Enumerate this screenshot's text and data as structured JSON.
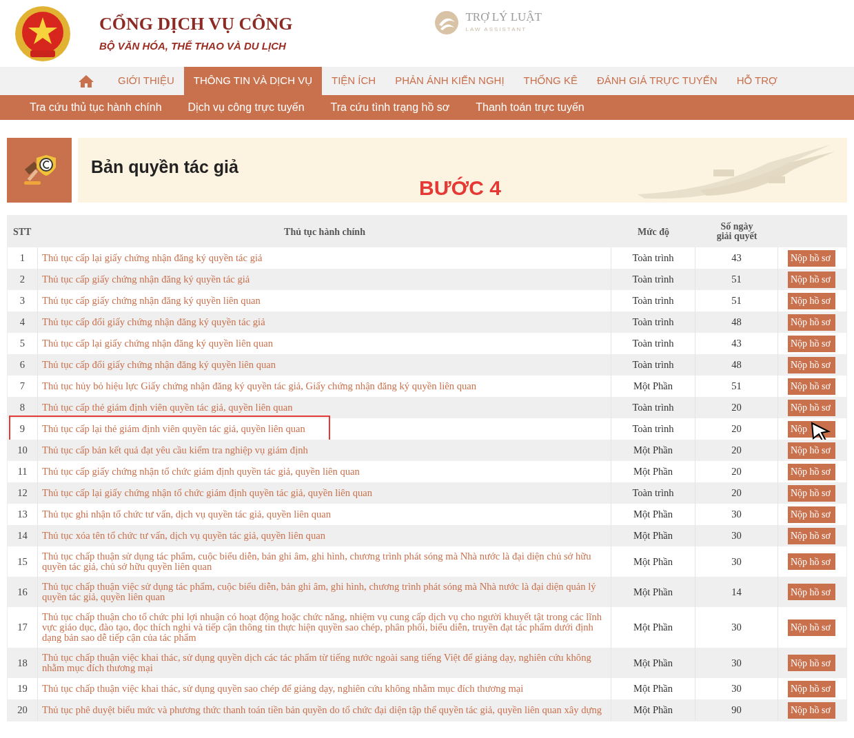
{
  "header": {
    "portal_title": "CỔNG DỊCH VỤ CÔNG",
    "portal_subtitle": "BỘ VĂN HÓA, THỂ THAO VÀ DU LỊCH",
    "partner_name": "TRỢ LÝ LUẬT",
    "partner_tagline": "LAW ASSISTANT"
  },
  "nav": [
    {
      "label": "GIỚI THIỆU",
      "selected": false
    },
    {
      "label": "THÔNG TIN VÀ DỊCH VỤ",
      "selected": true
    },
    {
      "label": "TIỆN ÍCH",
      "selected": false
    },
    {
      "label": "PHẢN ÁNH KIẾN NGHỊ",
      "selected": false
    },
    {
      "label": "THỐNG KÊ",
      "selected": false
    },
    {
      "label": "ĐÁNH GIÁ TRỰC TUYẾN",
      "selected": false
    },
    {
      "label": "HỖ TRỢ",
      "selected": false
    }
  ],
  "subnav": [
    "Tra cứu thủ tục hành chính",
    "Dịch vụ công trực tuyến",
    "Tra cứu tình trạng hồ sơ",
    "Thanh toán trực tuyến"
  ],
  "banner": {
    "title": "Bản quyền tác giả",
    "step_label": "BƯỚC 4"
  },
  "table": {
    "columns": [
      "STT",
      "Thủ tục hành chính",
      "Mức độ",
      "Số ngày giải quyết"
    ],
    "rows": [
      {
        "stt": "1",
        "name": "Thủ tục cấp lại giấy chứng nhận đăng ký quyền tác giả",
        "level": "Toàn trình",
        "days": "43",
        "button": "Nộp hồ sơ",
        "highlighted": false,
        "cursor": false
      },
      {
        "stt": "2",
        "name": "Thủ tục cấp giấy chứng nhận đăng ký quyền tác giả",
        "level": "Toàn trình",
        "days": "51",
        "button": "Nộp hồ sơ",
        "highlighted": false,
        "cursor": false
      },
      {
        "stt": "3",
        "name": "Thủ tục cấp giấy chứng nhận đăng ký quyền liên quan",
        "level": "Toàn trình",
        "days": "51",
        "button": "Nộp hồ sơ",
        "highlighted": false,
        "cursor": false
      },
      {
        "stt": "4",
        "name": "Thủ tục cấp đổi giấy chứng nhận đăng ký quyền tác giả",
        "level": "Toàn trình",
        "days": "48",
        "button": "Nộp hồ sơ",
        "highlighted": false,
        "cursor": false
      },
      {
        "stt": "5",
        "name": "Thủ tục cấp lại giấy chứng nhận đăng ký quyền liên quan",
        "level": "Toàn trình",
        "days": "43",
        "button": "Nộp hồ sơ",
        "highlighted": false,
        "cursor": false
      },
      {
        "stt": "6",
        "name": "Thủ tục cấp đổi giấy chứng nhận đăng ký quyền liên quan",
        "level": "Toàn trình",
        "days": "48",
        "button": "Nộp hồ sơ",
        "highlighted": false,
        "cursor": false
      },
      {
        "stt": "7",
        "name": "Thủ tục hủy bỏ hiệu lực Giấy chứng nhận đăng ký quyền tác giả, Giấy chứng nhận đăng ký quyền liên quan",
        "level": "Một Phần",
        "days": "51",
        "button": "Nộp hồ sơ",
        "highlighted": false,
        "cursor": false
      },
      {
        "stt": "8",
        "name": "Thủ tục cấp thẻ giám định viên quyền tác giả, quyền liên quan",
        "level": "Toàn trình",
        "days": "20",
        "button": "Nộp hồ sơ",
        "highlighted": false,
        "cursor": false
      },
      {
        "stt": "9",
        "name": "Thủ tục cấp lại thẻ giám định viên quyền tác giả, quyền liên quan",
        "level": "Toàn trình",
        "days": "20",
        "button": "Nộp",
        "highlighted": true,
        "cursor": true
      },
      {
        "stt": "10",
        "name": "Thủ tục cấp bản kết quả đạt yêu cầu kiểm tra nghiệp vụ giám định",
        "level": "Một Phần",
        "days": "20",
        "button": "Nộp hồ sơ",
        "highlighted": false,
        "cursor": false
      },
      {
        "stt": "11",
        "name": "Thủ tục cấp giấy chứng nhận tổ chức giám định quyền tác giả, quyền liên quan",
        "level": "Một Phần",
        "days": "20",
        "button": "Nộp hồ sơ",
        "highlighted": false,
        "cursor": false
      },
      {
        "stt": "12",
        "name": "Thủ tục cấp lại giấy chứng nhận tổ chức giám định quyền tác giả, quyền liên quan",
        "level": "Toàn trình",
        "days": "20",
        "button": "Nộp hồ sơ",
        "highlighted": false,
        "cursor": false
      },
      {
        "stt": "13",
        "name": "Thủ tục ghi nhận tổ chức tư vấn, dịch vụ quyền tác giả, quyền liên quan",
        "level": "Một Phần",
        "days": "30",
        "button": "Nộp hồ sơ",
        "highlighted": false,
        "cursor": false
      },
      {
        "stt": "14",
        "name": "Thủ tục xóa tên tổ chức tư vấn, dịch vụ quyền tác giả, quyền liên quan",
        "level": "Một Phần",
        "days": "30",
        "button": "Nộp hồ sơ",
        "highlighted": false,
        "cursor": false
      },
      {
        "stt": "15",
        "name": "Thủ tục chấp thuận sử dụng tác phẩm, cuộc biểu diễn, bản ghi âm, ghi hình, chương trình phát sóng mà Nhà nước là đại diện chủ sở hữu quyền tác giả, chủ sở hữu quyền liên quan",
        "level": "Một Phần",
        "days": "30",
        "button": "Nộp hồ sơ",
        "highlighted": false,
        "cursor": false
      },
      {
        "stt": "16",
        "name": "Thủ tục chấp thuận việc sử dụng tác phẩm, cuộc biểu diễn, bản ghi âm, ghi hình, chương trình phát sóng mà Nhà nước là đại diện quản lý quyền tác giả, quyền liên quan",
        "level": "Một Phần",
        "days": "14",
        "button": "Nộp hồ sơ",
        "highlighted": false,
        "cursor": false
      },
      {
        "stt": "17",
        "name": "Thủ tục chấp thuận cho tổ chức phi lợi nhuận có hoạt động hoặc chức năng, nhiệm vụ cung cấp dịch vụ cho người khuyết tật trong các lĩnh vực giáo dục, đào tạo, đọc thích nghi và tiếp cận thông tin thực hiện quyền sao chép, phân phối, biểu diễn, truyền đạt tác phẩm dưới định dạng bản sao dễ tiếp cận của tác phẩm",
        "level": "Một Phần",
        "days": "30",
        "button": "Nộp hồ sơ",
        "highlighted": false,
        "cursor": false
      },
      {
        "stt": "18",
        "name": "Thủ tục chấp thuận việc khai thác, sử dụng quyền dịch các tác phẩm từ tiếng nước ngoài sang tiếng Việt để giảng dạy, nghiên cứu không nhằm mục đích thương mại",
        "level": "Một Phần",
        "days": "30",
        "button": "Nộp hồ sơ",
        "highlighted": false,
        "cursor": false
      },
      {
        "stt": "19",
        "name": "Thủ tục chấp thuận việc khai thác, sử dụng quyền sao chép để giảng dạy, nghiên cứu không nhằm mục đích thương mại",
        "level": "Một Phần",
        "days": "30",
        "button": "Nộp hồ sơ",
        "highlighted": false,
        "cursor": false
      },
      {
        "stt": "20",
        "name": "Thủ tục phê duyệt biểu mức và phương thức thanh toán tiền bản quyền do tổ chức đại diện tập thể quyền tác giả, quyền liên quan xây dựng",
        "level": "Một Phần",
        "days": "90",
        "button": "Nộp hồ sơ",
        "highlighted": false,
        "cursor": false
      }
    ]
  }
}
